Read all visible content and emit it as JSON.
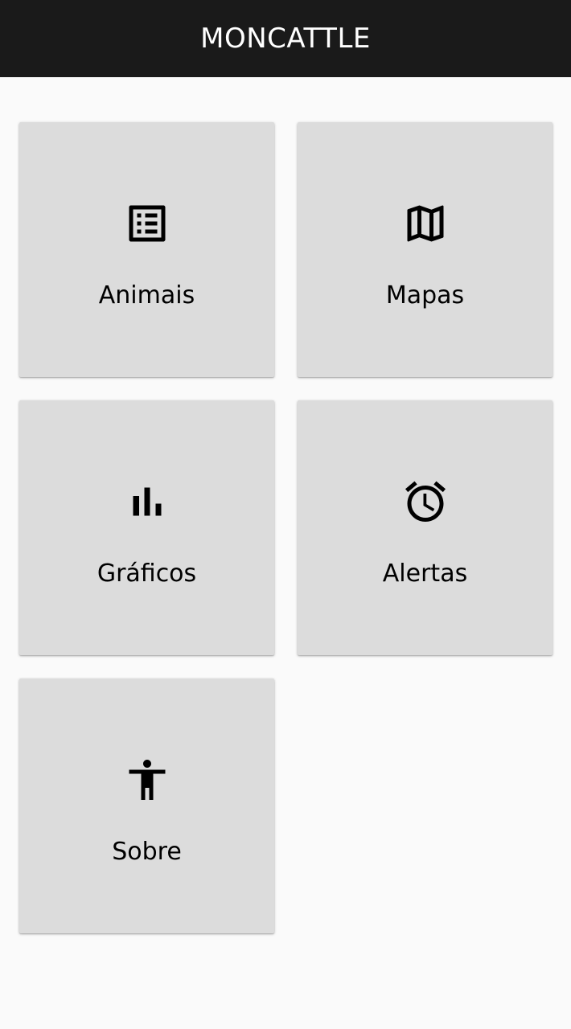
{
  "app_bar": {
    "title": "MONCATTLE"
  },
  "colors": {
    "app_bar": "#1a1a1a",
    "tile": "#dcdcdc",
    "background": "#fafafa",
    "text": "#000000"
  },
  "menu": {
    "items": [
      {
        "label": "Animais",
        "icon": "list-alt-icon"
      },
      {
        "label": "Mapas",
        "icon": "map-icon"
      },
      {
        "label": "Gráficos",
        "icon": "bar-chart-icon"
      },
      {
        "label": "Alertas",
        "icon": "alarm-icon"
      },
      {
        "label": "Sobre",
        "icon": "accessibility-icon"
      }
    ]
  }
}
